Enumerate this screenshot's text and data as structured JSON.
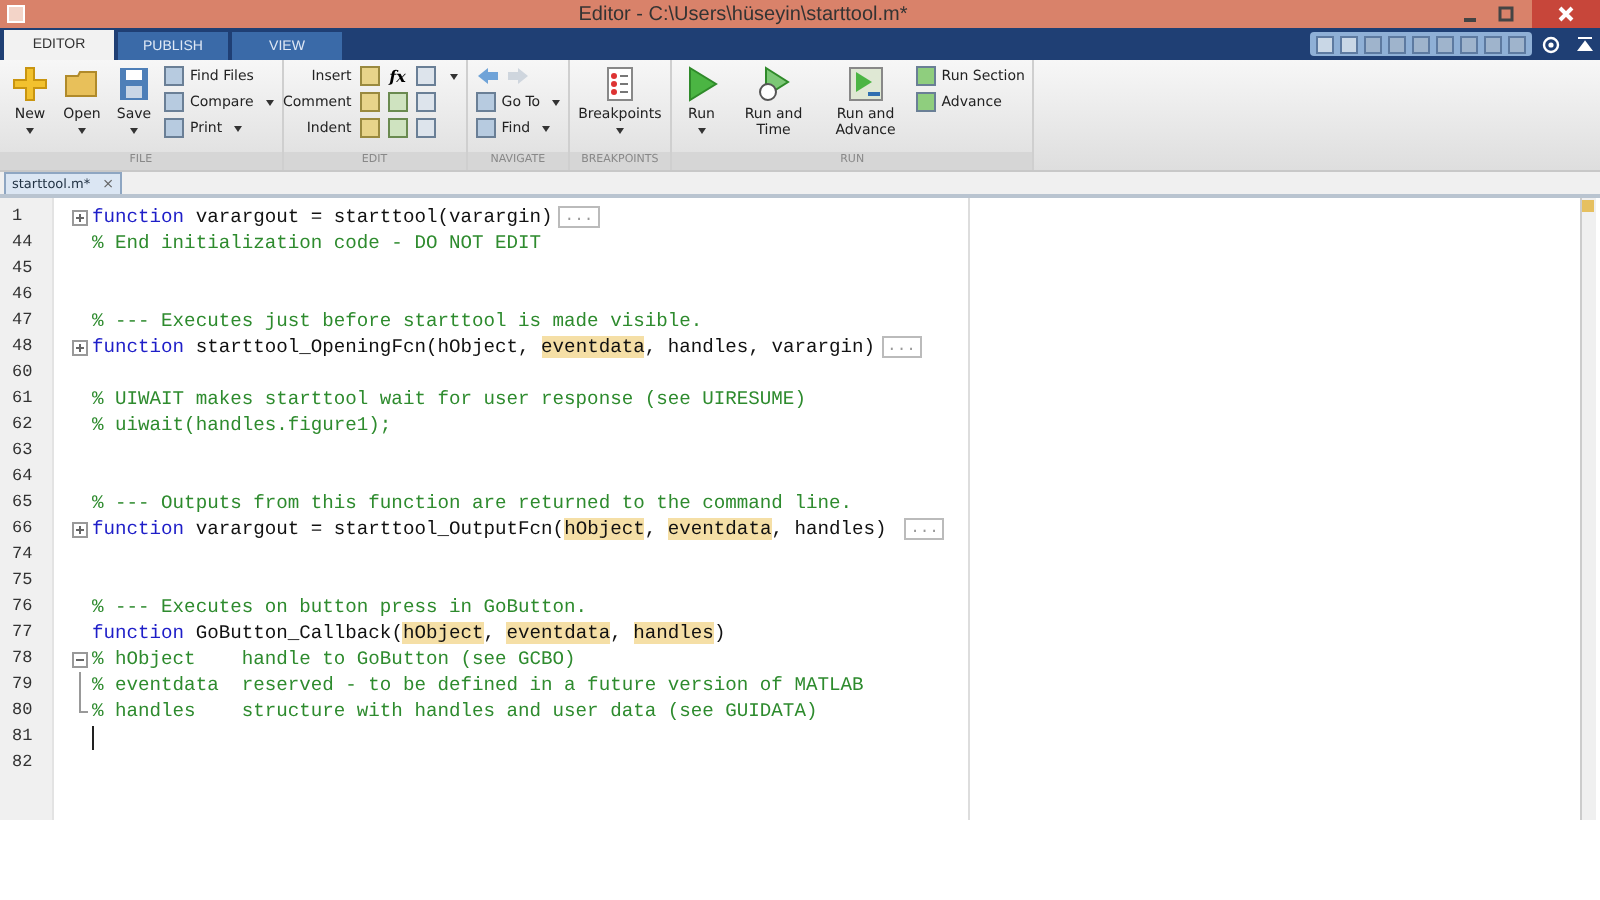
{
  "window": {
    "title": "Editor - C:\\Users\\hüseyin\\starttool.m*"
  },
  "tabs": [
    {
      "label": "EDITOR",
      "selected": true
    },
    {
      "label": "PUBLISH",
      "selected": false
    },
    {
      "label": "VIEW",
      "selected": false
    }
  ],
  "ribbon": [
    {
      "title": "FILE",
      "items": [
        {
          "kind": "large",
          "label": "New",
          "dropdown": true
        },
        {
          "kind": "large",
          "label": "Open",
          "dropdown": true
        },
        {
          "kind": "large",
          "label": "Save",
          "dropdown": true
        },
        {
          "kind": "stack",
          "rows": [
            {
              "label": "Find Files",
              "dropdown": false
            },
            {
              "label": "Compare",
              "dropdown": true
            },
            {
              "label": "Print",
              "dropdown": true
            }
          ]
        }
      ]
    },
    {
      "title": "EDIT",
      "items": [
        {
          "kind": "grid",
          "rows": [
            {
              "label": "Insert",
              "glyph": "fx",
              "dropdown": true
            },
            {
              "label": "Comment",
              "dropdown": false
            },
            {
              "label": "Indent",
              "dropdown": false
            }
          ]
        }
      ]
    },
    {
      "title": "NAVIGATE",
      "items": [
        {
          "kind": "stack",
          "rows": [
            {
              "kind": "arrows"
            },
            {
              "label": "Go To",
              "dropdown": true
            },
            {
              "label": "Find",
              "dropdown": true
            }
          ]
        }
      ]
    },
    {
      "title": "BREAKPOINTS",
      "items": [
        {
          "kind": "large",
          "label": "Breakpoints",
          "dropdown": true
        }
      ]
    },
    {
      "title": "RUN",
      "items": [
        {
          "kind": "large",
          "label": "Run",
          "dropdown": true
        },
        {
          "kind": "large",
          "label": "Run and Time",
          "dropdown": false
        },
        {
          "kind": "large",
          "label": "Run and Advance",
          "dropdown": false
        },
        {
          "kind": "stack",
          "rows": [
            {
              "label": "Run Section",
              "dropdown": false
            },
            {
              "label": "Advance",
              "dropdown": false
            }
          ]
        }
      ]
    }
  ],
  "document_tab": {
    "label": "starttool.m*",
    "close": "×"
  },
  "code": [
    {
      "number": "1",
      "kind": "folded",
      "parts": [
        {
          "kind": "keyword",
          "text": "function"
        },
        {
          "kind": "plain",
          "text": " varargout = starttool(varargin)"
        }
      ],
      "collapsed": "..."
    },
    {
      "number": "44",
      "kind": "plain",
      "parts": [
        {
          "kind": "comment",
          "text": "% End initialization code - DO NOT EDIT"
        }
      ]
    },
    {
      "number": "45",
      "kind": "plain"
    },
    {
      "number": "46",
      "kind": "plain"
    },
    {
      "number": "47",
      "kind": "plain",
      "parts": [
        {
          "kind": "comment",
          "text": "% --- Executes just before starttool is made visible."
        }
      ]
    },
    {
      "number": "48",
      "kind": "folded",
      "parts": [
        {
          "kind": "keyword",
          "text": "function"
        },
        {
          "kind": "plain",
          "text": " starttool_OpeningFcn(hObject, "
        },
        {
          "kind": "var",
          "text": "eventdata"
        },
        {
          "kind": "plain",
          "text": ", handles, varargin)"
        }
      ],
      "collapsed": "..."
    },
    {
      "number": "60",
      "kind": "plain"
    },
    {
      "number": "61",
      "kind": "plain",
      "parts": [
        {
          "kind": "comment",
          "text": "% UIWAIT makes starttool wait for user response (see UIRESUME)"
        }
      ]
    },
    {
      "number": "62",
      "kind": "plain",
      "parts": [
        {
          "kind": "comment",
          "text": "% uiwait(handles.figure1);"
        }
      ]
    },
    {
      "number": "63",
      "kind": "plain"
    },
    {
      "number": "64",
      "kind": "plain"
    },
    {
      "number": "65",
      "kind": "plain",
      "parts": [
        {
          "kind": "comment",
          "text": "% --- Outputs from this function are returned to the command line."
        }
      ]
    },
    {
      "number": "66",
      "kind": "folded",
      "parts": [
        {
          "kind": "keyword",
          "text": "function"
        },
        {
          "kind": "plain",
          "text": " varargout = starttool_OutputFcn("
        },
        {
          "kind": "var",
          "text": "hObject"
        },
        {
          "kind": "plain",
          "text": ", "
        },
        {
          "kind": "var",
          "text": "eventdata"
        },
        {
          "kind": "plain",
          "text": ", handles) "
        }
      ],
      "collapsed": "..."
    },
    {
      "number": "74",
      "kind": "plain"
    },
    {
      "number": "75",
      "kind": "plain"
    },
    {
      "number": "76",
      "kind": "plain",
      "parts": [
        {
          "kind": "comment",
          "text": "% --- Executes on button press in GoButton."
        }
      ]
    },
    {
      "number": "77",
      "kind": "plain",
      "parts": [
        {
          "kind": "keyword",
          "text": "function"
        },
        {
          "kind": "plain",
          "text": " GoButton_Callback("
        },
        {
          "kind": "var",
          "text": "hObject"
        },
        {
          "kind": "plain",
          "text": ", "
        },
        {
          "kind": "var",
          "text": "eventdata"
        },
        {
          "kind": "plain",
          "text": ", "
        },
        {
          "kind": "var",
          "text": "handles"
        },
        {
          "kind": "plain",
          "text": ")"
        }
      ]
    },
    {
      "number": "78",
      "kind": "fold-start",
      "parts": [
        {
          "kind": "comment",
          "text": "% hObject    handle to GoButton (see GCBO)"
        }
      ]
    },
    {
      "number": "79",
      "kind": "fold-body",
      "parts": [
        {
          "kind": "comment",
          "text": "% eventdata  reserved - to be defined in a future version of MATLAB"
        }
      ]
    },
    {
      "number": "80",
      "kind": "fold-end",
      "parts": [
        {
          "kind": "comment",
          "text": "% handles    structure with handles and user data (see GUIDATA)"
        }
      ]
    },
    {
      "number": "81",
      "kind": "plain",
      "cursor": true
    },
    {
      "number": "82",
      "kind": "plain"
    }
  ]
}
